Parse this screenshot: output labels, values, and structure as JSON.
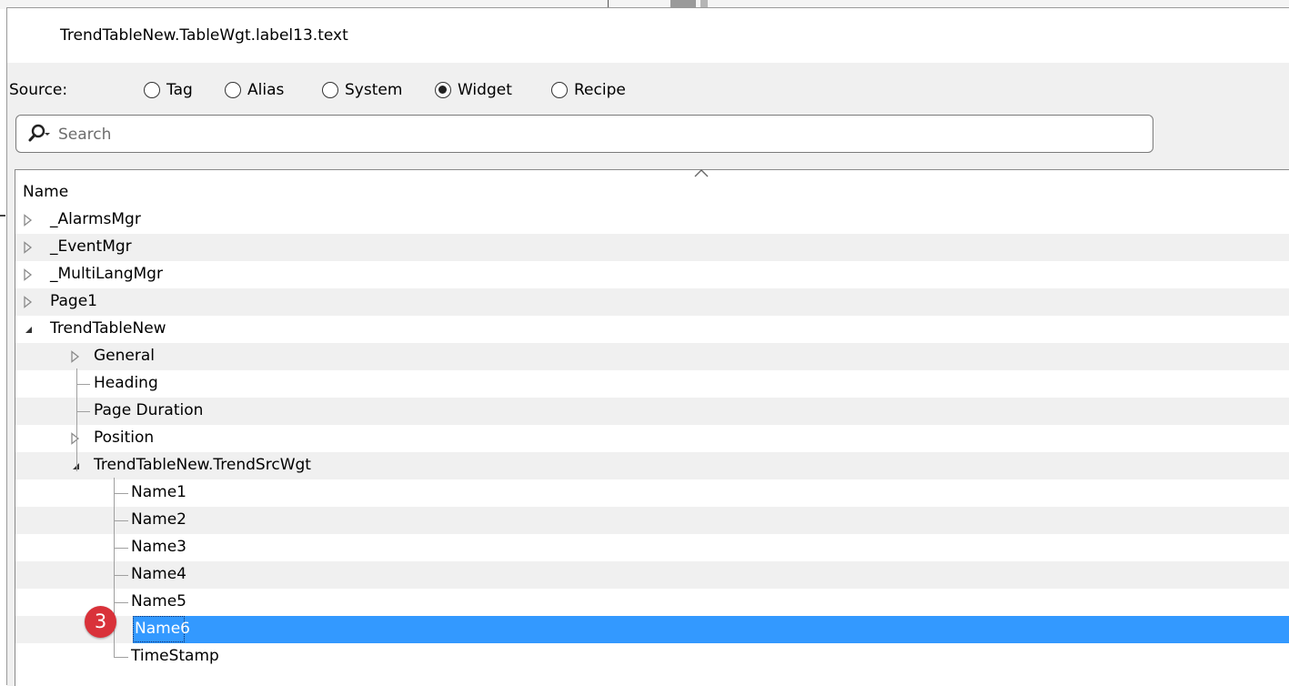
{
  "dialog": {
    "title": "TrendTableNew.TableWgt.label13.text"
  },
  "source": {
    "label": "Source:",
    "options": [
      {
        "label": "Tag",
        "checked": false
      },
      {
        "label": "Alias",
        "checked": false
      },
      {
        "label": "System",
        "checked": false
      },
      {
        "label": "Widget",
        "checked": true
      },
      {
        "label": "Recipe",
        "checked": false
      }
    ]
  },
  "search": {
    "placeholder": "Search",
    "value": "",
    "icon": "search-icon"
  },
  "tree": {
    "column_header": "Name",
    "items": [
      {
        "label": "_AlarmsMgr",
        "expander": "collapsed"
      },
      {
        "label": "_EventMgr",
        "expander": "collapsed"
      },
      {
        "label": "_MultiLangMgr",
        "expander": "collapsed"
      },
      {
        "label": "Page1",
        "expander": "collapsed"
      },
      {
        "label": "TrendTableNew",
        "expander": "expanded"
      },
      {
        "label": "General",
        "expander": "collapsed"
      },
      {
        "label": "Heading",
        "expander": "none"
      },
      {
        "label": "Page Duration",
        "expander": "none"
      },
      {
        "label": "Position",
        "expander": "collapsed"
      },
      {
        "label": "TrendTableNew.TrendSrcWgt",
        "expander": "expanded"
      },
      {
        "label": "Name1",
        "expander": "none"
      },
      {
        "label": "Name2",
        "expander": "none"
      },
      {
        "label": "Name3",
        "expander": "none"
      },
      {
        "label": "Name4",
        "expander": "none"
      },
      {
        "label": "Name5",
        "expander": "none"
      },
      {
        "label": "Name6",
        "expander": "none",
        "selected": true
      },
      {
        "label": "TimeStamp",
        "expander": "none"
      }
    ]
  },
  "callout_badge": {
    "text": "3",
    "color": "#d9323a"
  },
  "colors": {
    "selection": "#3399ff",
    "alt_row": "#f0f0f0",
    "panel_bg": "#f0f0f0"
  }
}
